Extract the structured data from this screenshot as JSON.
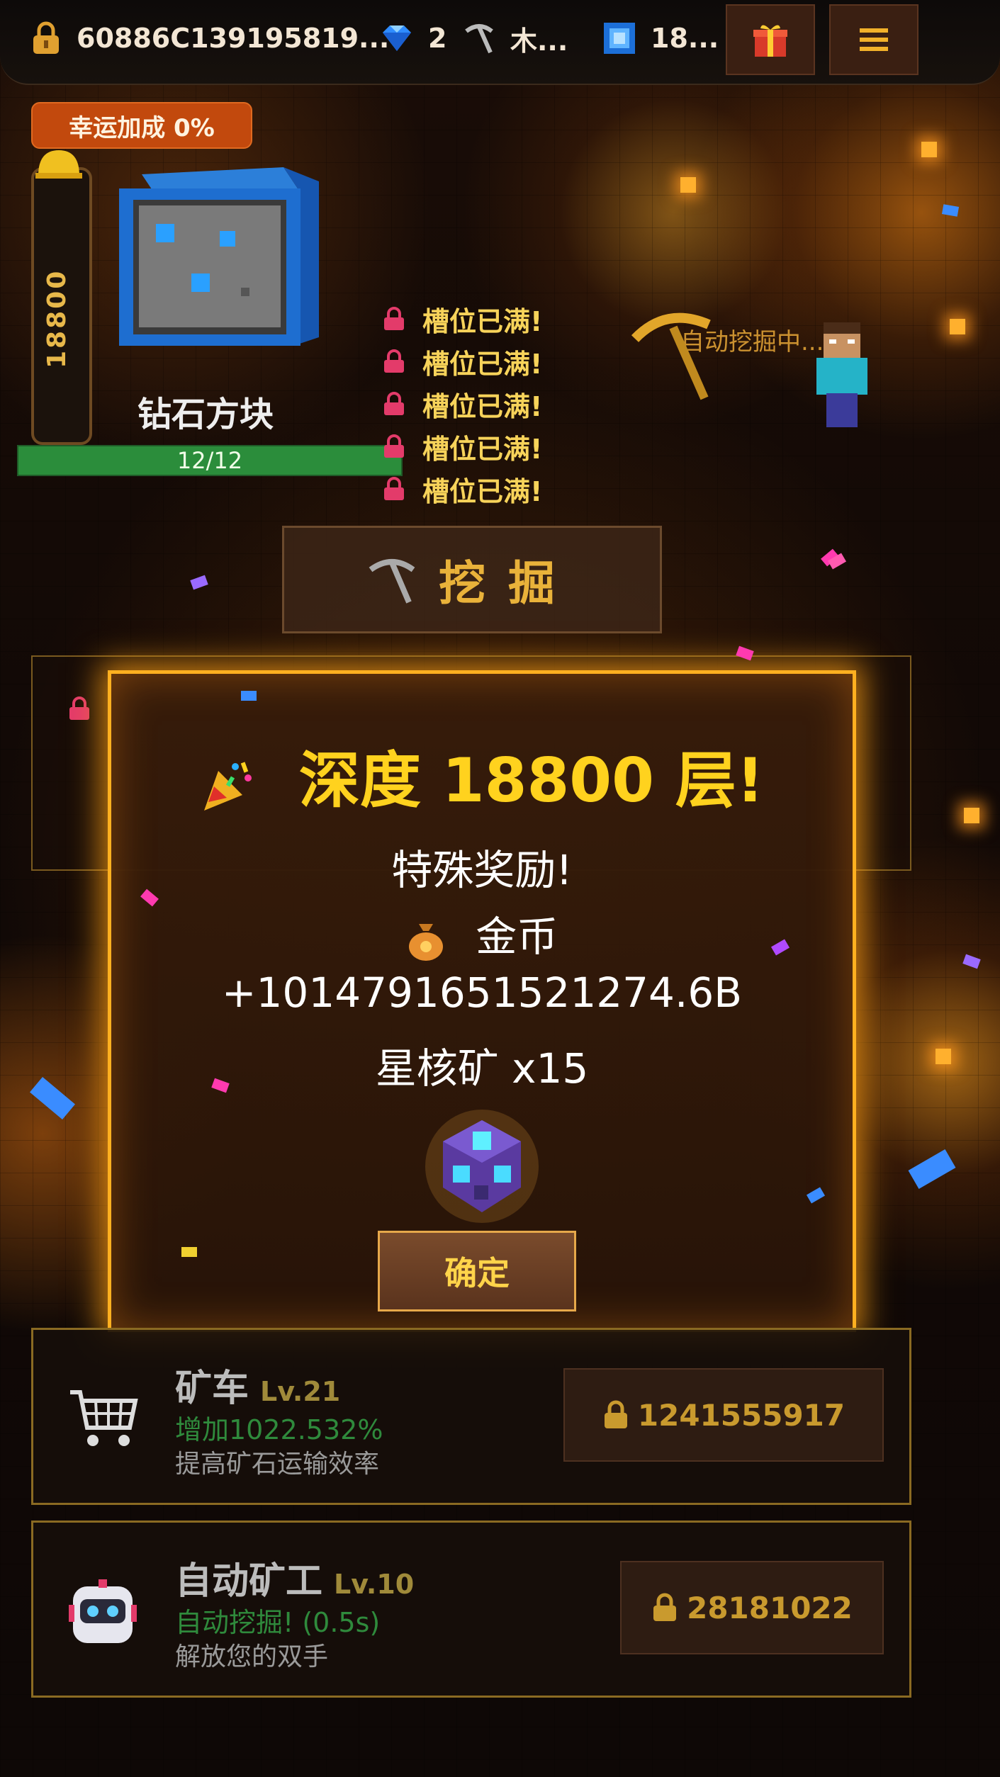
{
  "topbar": {
    "account_id": "60886C139195819...",
    "diamonds": "2",
    "pickaxe": "木...",
    "blocks": "18..."
  },
  "luck": {
    "label": "幸运加成 0%"
  },
  "depth_meter": {
    "value": "18800"
  },
  "current_block": {
    "name": "钻石方块",
    "progress": "12/12",
    "fill": 1.0
  },
  "slots": [
    "槽位已满!",
    "槽位已满!",
    "槽位已满!",
    "槽位已满!",
    "槽位已满!"
  ],
  "miner_tag": "自动挖掘中...",
  "dig_button": {
    "label": "挖掘"
  },
  "modal": {
    "title": "深度 18800 层!",
    "subtitle": "特殊奖励!",
    "coin_label": "金币",
    "coin_amount": "+1014791651521274.6B",
    "item_reward": "星核矿 x15",
    "confirm": "确定"
  },
  "upgrades": [
    {
      "name": "矿车",
      "level": "Lv.21",
      "effect": "增加1022.532%",
      "desc": "提高矿石运输效率",
      "price": "1241555917"
    },
    {
      "name": "自动矿工",
      "level": "Lv.10",
      "effect": "自动挖掘! (0.5s)",
      "desc": "解放您的双手",
      "price": "28181022"
    }
  ],
  "colors": {
    "accent": "#ffd21e",
    "modal_border": "#ffb020",
    "progress": "#2b8d3b",
    "luck_badge": "#c2490d"
  },
  "icons": [
    "lock-icon",
    "diamond-icon",
    "pickaxe-icon",
    "block-icon",
    "gift-icon",
    "menu-icon",
    "party-popper-icon",
    "coin-bag-icon",
    "star-core-ore-icon",
    "minecart-icon",
    "robot-icon"
  ]
}
